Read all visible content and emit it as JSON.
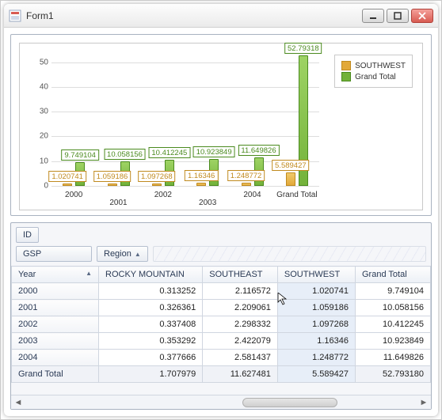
{
  "window": {
    "title": "Form1"
  },
  "legend": {
    "southwest": "SOUTHWEST",
    "grand_total": "Grand Total"
  },
  "chart_data": {
    "type": "bar",
    "categories": [
      "2000",
      "2001",
      "2002",
      "2003",
      "2004",
      "Grand Total"
    ],
    "series": [
      {
        "name": "SOUTHWEST",
        "values": [
          1.020741,
          1.059186,
          1.097268,
          1.16346,
          1.248772,
          5.589427
        ]
      },
      {
        "name": "Grand Total",
        "values": [
          9.749104,
          10.058156,
          10.412245,
          10.923849,
          11.649826,
          52.79318
        ]
      }
    ],
    "ylim": [
      0,
      55
    ],
    "yticks": [
      0,
      10,
      20,
      30,
      40,
      50
    ],
    "data_labels": {
      "SOUTHWEST": [
        "1.020741",
        "1.059186",
        "1.097268",
        "1.16346",
        "1.248772",
        "5.589427"
      ],
      "Grand Total": [
        "9.749104",
        "10.058156",
        "10.412245",
        "10.923849",
        "11.649826",
        "52.79318"
      ]
    }
  },
  "pivot": {
    "id_field": "ID",
    "data_field": "GSP",
    "col_field": "Region",
    "row_field": "Year",
    "sort": "asc",
    "columns": [
      "ROCKY MOUNTAIN",
      "SOUTHEAST",
      "SOUTHWEST",
      "Grand Total"
    ],
    "rows": [
      {
        "year": "2000",
        "vals": [
          "0.313252",
          "2.116572",
          "1.020741",
          "9.749104"
        ]
      },
      {
        "year": "2001",
        "vals": [
          "0.326361",
          "2.209061",
          "1.059186",
          "10.058156"
        ]
      },
      {
        "year": "2002",
        "vals": [
          "0.337408",
          "2.298332",
          "1.097268",
          "10.412245"
        ]
      },
      {
        "year": "2003",
        "vals": [
          "0.353292",
          "2.422079",
          "1.16346",
          "10.923849"
        ]
      },
      {
        "year": "2004",
        "vals": [
          "0.377666",
          "2.581437",
          "1.248772",
          "11.649826"
        ]
      }
    ],
    "grand_total_label": "Grand Total",
    "grand_total_vals": [
      "1.707979",
      "11.627481",
      "5.589427",
      "52.793180"
    ]
  }
}
